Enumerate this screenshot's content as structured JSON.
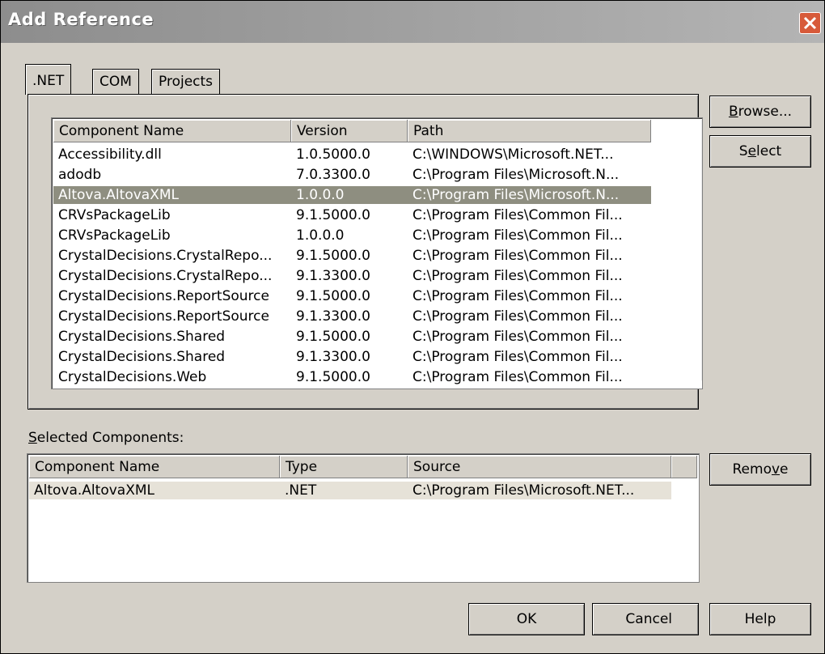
{
  "window": {
    "title": "Add Reference"
  },
  "tabs": [
    {
      "label": ".NET"
    },
    {
      "label": "COM"
    },
    {
      "label": "Projects"
    }
  ],
  "buttons": {
    "browse": {
      "pre": "",
      "mn": "B",
      "post": "rowse..."
    },
    "select": {
      "pre": "S",
      "mn": "e",
      "post": "lect"
    },
    "remove": {
      "pre": "Remo",
      "mn": "v",
      "post": "e"
    },
    "ok": "OK",
    "cancel": "Cancel",
    "help": "Help"
  },
  "component_list": {
    "headers": [
      "Component Name",
      "Version",
      "Path"
    ],
    "rows": [
      {
        "name": "Accessibility.dll",
        "version": "1.0.5000.0",
        "path": "C:\\WINDOWS\\Microsoft.NET..."
      },
      {
        "name": "adodb",
        "version": "7.0.3300.0",
        "path": "C:\\Program Files\\Microsoft.N..."
      },
      {
        "name": "Altova.AltovaXML",
        "version": "1.0.0.0",
        "path": "C:\\Program Files\\Microsoft.N..."
      },
      {
        "name": "CRVsPackageLib",
        "version": "9.1.5000.0",
        "path": "C:\\Program Files\\Common Fil..."
      },
      {
        "name": "CRVsPackageLib",
        "version": "1.0.0.0",
        "path": "C:\\Program Files\\Common Fil..."
      },
      {
        "name": "CrystalDecisions.CrystalRepo...",
        "version": "9.1.5000.0",
        "path": "C:\\Program Files\\Common Fil..."
      },
      {
        "name": "CrystalDecisions.CrystalRepo...",
        "version": "9.1.3300.0",
        "path": "C:\\Program Files\\Common Fil..."
      },
      {
        "name": "CrystalDecisions.ReportSource",
        "version": "9.1.5000.0",
        "path": "C:\\Program Files\\Common Fil..."
      },
      {
        "name": "CrystalDecisions.ReportSource",
        "version": "9.1.3300.0",
        "path": "C:\\Program Files\\Common Fil..."
      },
      {
        "name": "CrystalDecisions.Shared",
        "version": "9.1.5000.0",
        "path": "C:\\Program Files\\Common Fil..."
      },
      {
        "name": "CrystalDecisions.Shared",
        "version": "9.1.3300.0",
        "path": "C:\\Program Files\\Common Fil..."
      },
      {
        "name": "CrystalDecisions.Web",
        "version": "9.1.5000.0",
        "path": "C:\\Program Files\\Common Fil..."
      }
    ],
    "selected_index": 2
  },
  "selected_components": {
    "label_mn": "S",
    "label_rest": "elected Components:",
    "headers": [
      "Component Name",
      "Type",
      "Source"
    ],
    "rows": [
      {
        "name": "Altova.AltovaXML",
        "type": ".NET",
        "source": "C:\\Program Files\\Microsoft.NET..."
      }
    ]
  },
  "icons": {
    "close": "close-icon",
    "scroll_up": "chevron-up-icon",
    "scroll_down": "chevron-down-icon"
  },
  "colors": {
    "dialog_bg": "#d4d0c8",
    "selection": "#8e8e80",
    "close_button": "#d75a3a"
  }
}
